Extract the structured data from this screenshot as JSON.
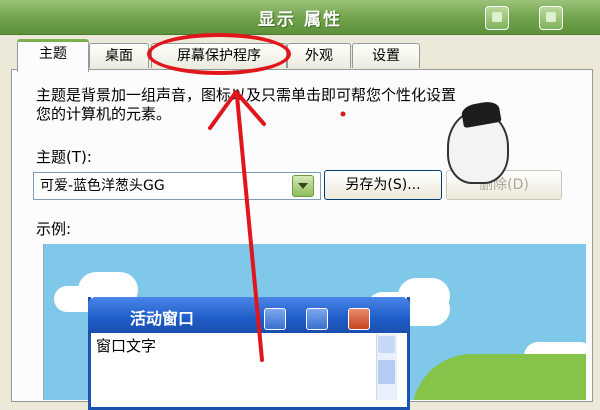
{
  "window": {
    "title": "显示 属性"
  },
  "tabs": [
    {
      "label": "主题",
      "active": true
    },
    {
      "label": "桌面",
      "active": false
    },
    {
      "label": "屏幕保护程序",
      "active": false
    },
    {
      "label": "外观",
      "active": false
    },
    {
      "label": "设置",
      "active": false
    }
  ],
  "description": {
    "line1": "主题是背景加一组声音，图标以及只需单击即可帮您个性化设置",
    "line2": "您的计算机的元素。"
  },
  "theme": {
    "label": "主题(T):",
    "selected": "可爱-蓝色洋葱头GG",
    "save_as_label": "另存为(S)...",
    "delete_label": "删除(D)"
  },
  "sample": {
    "label": "示例:",
    "active_window_title": "活动窗口",
    "window_text": "窗口文字"
  },
  "colors": {
    "annotation": "#e0161c",
    "titlebar": "#6fa24a",
    "preview_sky": "#7fc8ea"
  }
}
